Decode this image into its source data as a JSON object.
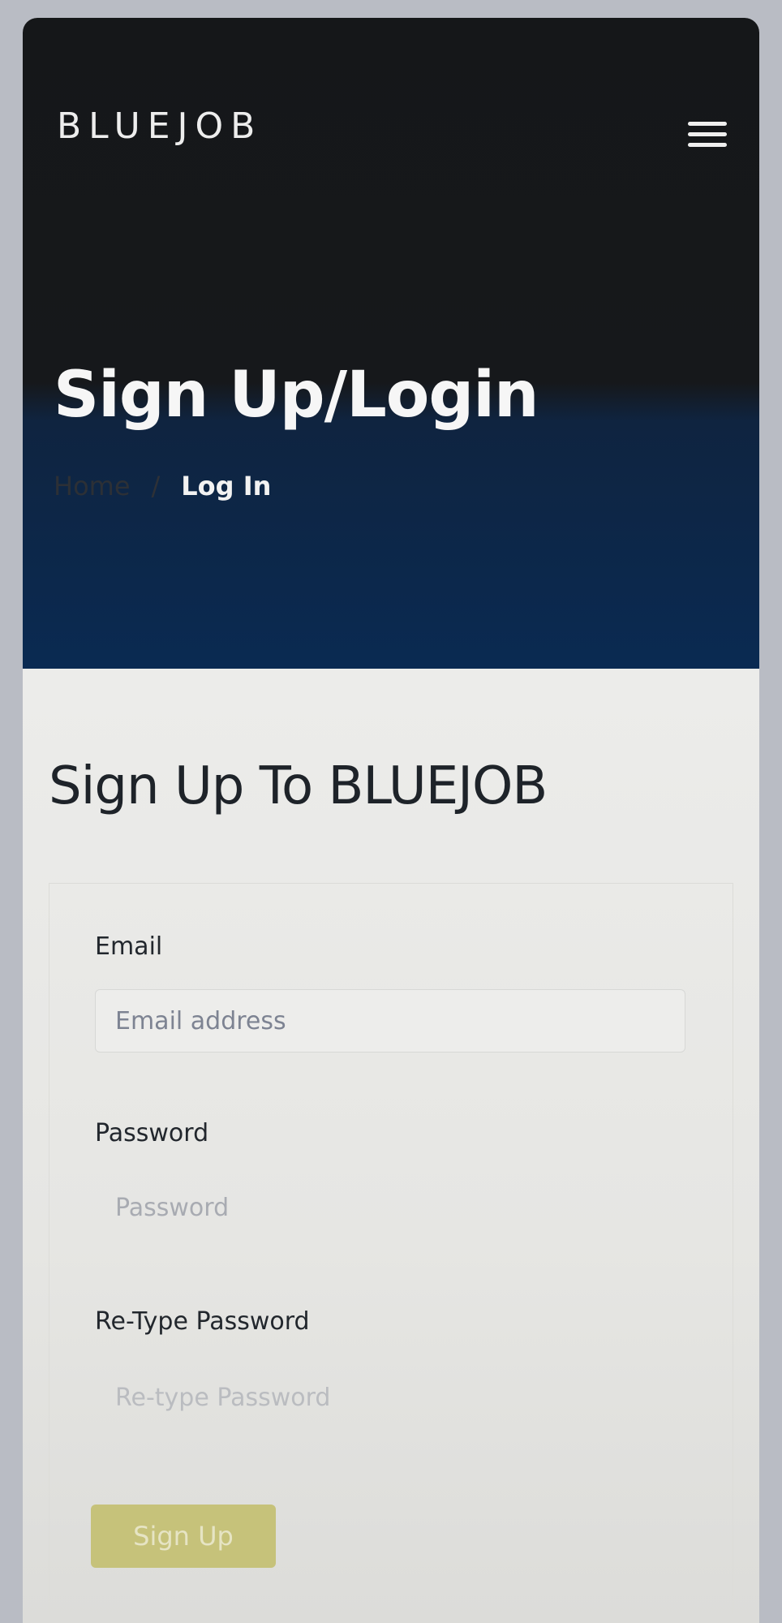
{
  "header": {
    "brand": "BLUEJOB",
    "menu_icon": "hamburger-menu-icon"
  },
  "hero": {
    "title": "Sign Up/Login",
    "breadcrumb": {
      "home": "Home",
      "separator": "/",
      "current": "Log In"
    }
  },
  "form": {
    "title": "Sign Up To BLUEJOB",
    "email": {
      "label": "Email",
      "placeholder": "Email address",
      "value": ""
    },
    "password": {
      "label": "Password",
      "placeholder": "Password",
      "value": ""
    },
    "retype_password": {
      "label": "Re-Type Password",
      "placeholder": "Re-type Password",
      "value": ""
    },
    "submit_label": "Sign Up"
  },
  "colors": {
    "hero_dark": "#16181b",
    "hero_blue": "#0a2a52",
    "button": "#c6c27a"
  }
}
